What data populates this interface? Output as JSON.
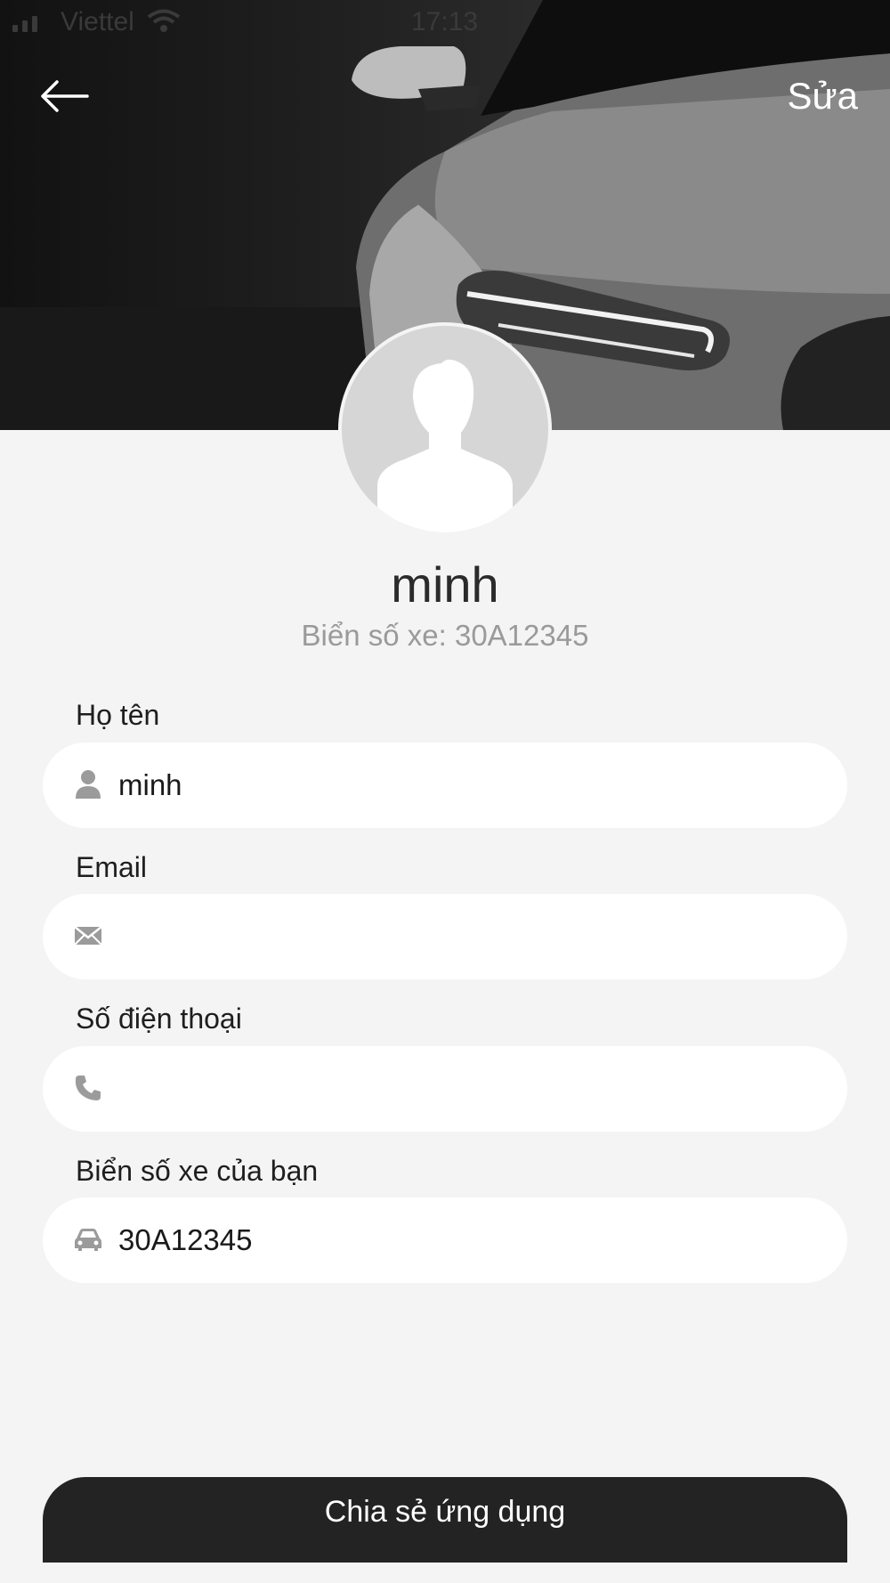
{
  "status_bar": {
    "carrier": "Viettel",
    "time": "17:13"
  },
  "header": {
    "edit_label": "Sửa",
    "back_icon": "arrow-left-icon"
  },
  "profile": {
    "name": "minh",
    "plate_line": "Biển số xe: 30A12345"
  },
  "form": {
    "full_name": {
      "label": "Họ tên",
      "value": "minh",
      "icon": "user-icon"
    },
    "email": {
      "label": "Email",
      "value": "",
      "icon": "envelope-icon"
    },
    "phone": {
      "label": "Số điện thoại",
      "value": "",
      "icon": "phone-icon"
    },
    "plate": {
      "label": "Biển số xe của bạn",
      "value": "30A12345",
      "icon": "car-icon"
    }
  },
  "share_button": {
    "label": "Chia sẻ ứng dụng"
  },
  "colors": {
    "background": "#f4f4f5",
    "field_bg": "#ffffff",
    "icon_gray": "#9b9b9b",
    "button_dark": "#232323"
  }
}
